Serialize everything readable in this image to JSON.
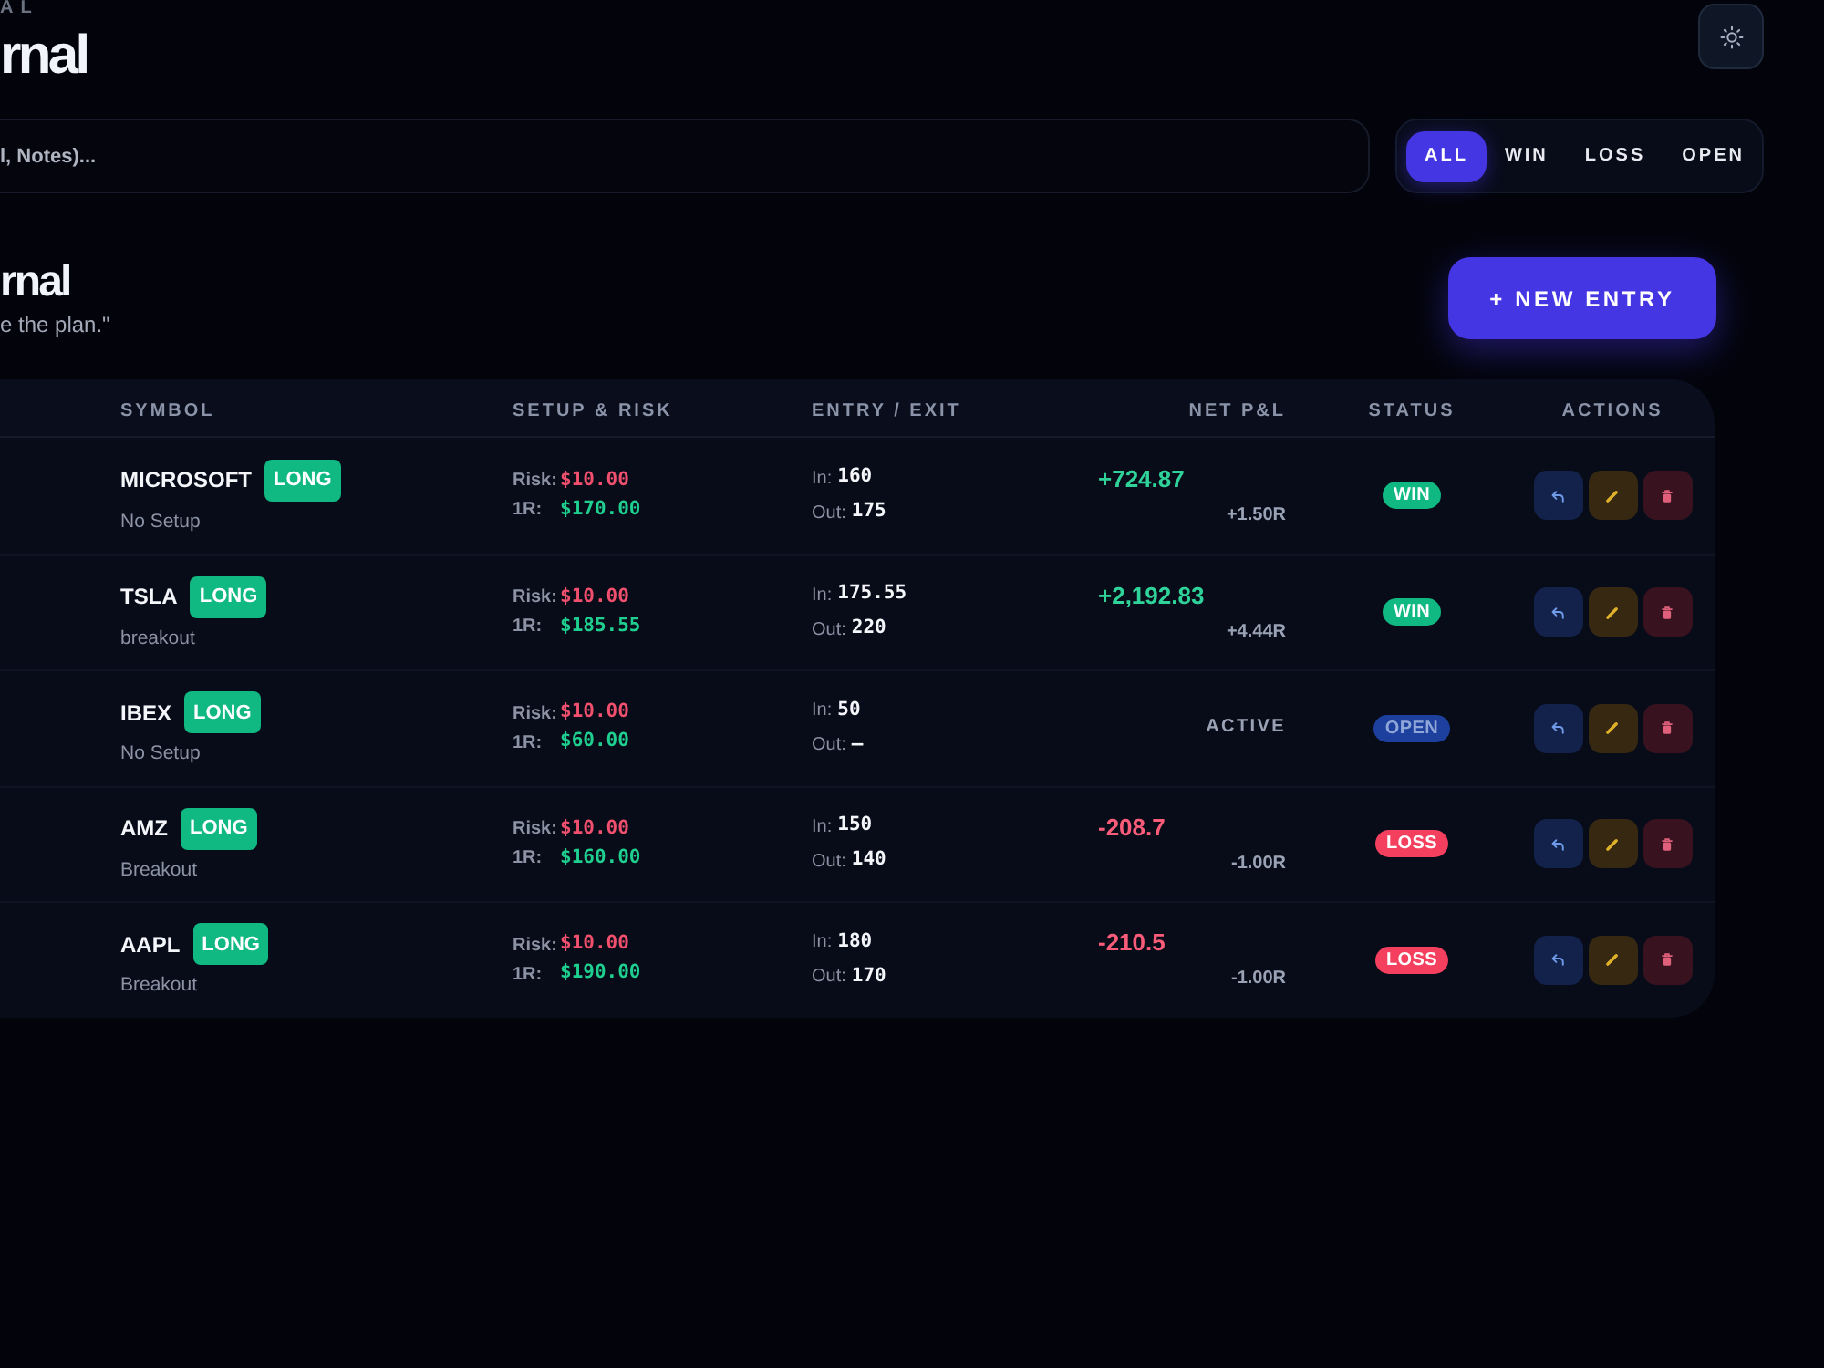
{
  "header": {
    "eyebrow": "AL",
    "title": "rnal"
  },
  "search": {
    "placeholder": "l, Notes)..."
  },
  "filters": [
    {
      "label": "ALL",
      "selected": true
    },
    {
      "label": "WIN",
      "selected": false
    },
    {
      "label": "LOSS",
      "selected": false
    },
    {
      "label": "OPEN",
      "selected": false
    }
  ],
  "section": {
    "title": "rnal",
    "subtitle": "e the plan.\"",
    "new_entry_button": "+ NEW ENTRY"
  },
  "table": {
    "columns": [
      "SYMBOL",
      "SETUP & RISK",
      "ENTRY / EXIT",
      "NET P&L",
      "STATUS",
      "ACTIONS"
    ],
    "rows": [
      {
        "symbol": "MICROSOFT",
        "side": "LONG",
        "setup": "No Setup",
        "risk_label": "Risk:",
        "risk": "$10.00",
        "one_r_label": "1R:",
        "one_r": "$170.00",
        "in_label": "In:",
        "in": "160",
        "out_label": "Out:",
        "out": "175",
        "pnl": {
          "text": "+724.87",
          "kind": "gain"
        },
        "r_multiple": "+1.50R",
        "status": {
          "label": "WIN",
          "kind": "win"
        }
      },
      {
        "symbol": "TSLA",
        "side": "LONG",
        "setup": "breakout",
        "risk_label": "Risk:",
        "risk": "$10.00",
        "one_r_label": "1R:",
        "one_r": "$185.55",
        "in_label": "In:",
        "in": "175.55",
        "out_label": "Out:",
        "out": "220",
        "pnl": {
          "text": "+2,192.83",
          "kind": "gain"
        },
        "r_multiple": "+4.44R",
        "status": {
          "label": "WIN",
          "kind": "win"
        }
      },
      {
        "symbol": "IBEX",
        "side": "LONG",
        "setup": "No Setup",
        "risk_label": "Risk:",
        "risk": "$10.00",
        "one_r_label": "1R:",
        "one_r": "$60.00",
        "in_label": "In:",
        "in": "50",
        "out_label": "Out:",
        "out": "–",
        "pnl_state": "ACTIVE",
        "status": {
          "label": "OPEN",
          "kind": "open"
        }
      },
      {
        "symbol": "AMZ",
        "side": "LONG",
        "setup": "Breakout",
        "risk_label": "Risk:",
        "risk": "$10.00",
        "one_r_label": "1R:",
        "one_r": "$160.00",
        "in_label": "In:",
        "in": "150",
        "out_label": "Out:",
        "out": "140",
        "pnl": {
          "text": "-208.7",
          "kind": "loss"
        },
        "r_multiple": "-1.00R",
        "status": {
          "label": "LOSS",
          "kind": "loss"
        }
      },
      {
        "symbol": "AAPL",
        "side": "LONG",
        "setup": "Breakout",
        "risk_label": "Risk:",
        "risk": "$10.00",
        "one_r_label": "1R:",
        "one_r": "$190.00",
        "in_label": "In:",
        "in": "180",
        "out_label": "Out:",
        "out": "170",
        "pnl": {
          "text": "-210.5",
          "kind": "loss"
        },
        "r_multiple": "-1.00R",
        "status": {
          "label": "LOSS",
          "kind": "loss"
        }
      }
    ]
  }
}
